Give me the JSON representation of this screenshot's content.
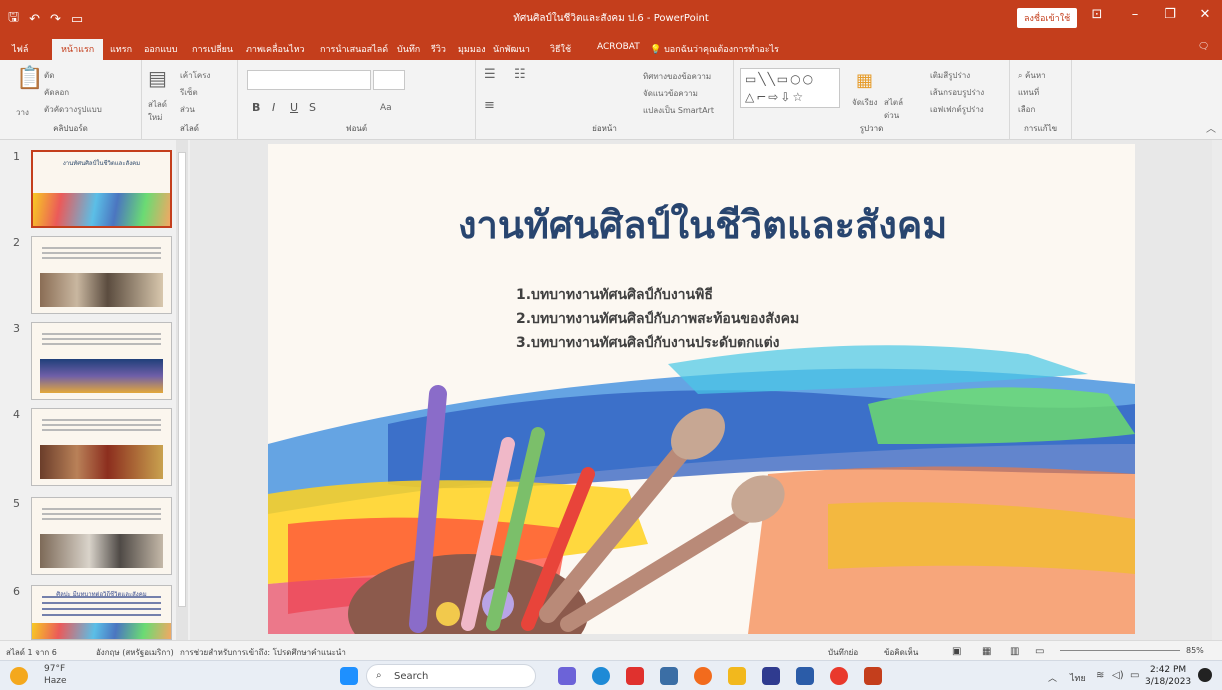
{
  "window": {
    "title": "ทัศนศิลป์ในชีวิตและสังคม ป.6  -  PowerPoint",
    "signin": "ลงชื่อเข้าใช้"
  },
  "tabs": [
    "ไฟล์",
    "หน้าแรก",
    "แทรก",
    "ออกแบบ",
    "การเปลี่ยน",
    "ภาพเคลื่อนไหว",
    "การนำเสนอสไลด์",
    "บันทึก",
    "รีวิว",
    "มุมมอง",
    "นักพัฒนา",
    "วิธีใช้",
    "ACROBAT"
  ],
  "tellme": "บอกฉันว่าคุณต้องการทำอะไร",
  "ribbon": {
    "clipboard": {
      "paste": "วาง",
      "cut": "ตัด",
      "copy": "คัดลอก",
      "format_painter": "ตัวคัดวางรูปแบบ",
      "label": "คลิปบอร์ด"
    },
    "slides": {
      "new_slide": "สไลด์ ใหม่",
      "layout": "เค้าโครง",
      "reset": "รีเซ็ต",
      "section": "ส่วน",
      "label": "สไลด์"
    },
    "font": {
      "label": "ฟอนต์",
      "bold": "B",
      "italic": "I",
      "underline": "U",
      "strike": "S",
      "case": "Aa"
    },
    "paragraph": {
      "text_direction": "ทิศทางของข้อความ",
      "align_text": "จัดแนวข้อความ",
      "smartart": "แปลงเป็น SmartArt",
      "label": "ย่อหน้า"
    },
    "drawing": {
      "arrange": "จัดเรียง",
      "quick_styles": "สไตล์ ด่วน",
      "fill": "เติมสีรูปร่าง",
      "outline": "เส้นกรอบรูปร่าง",
      "effects": "เอฟเฟกต์รูปร่าง",
      "label": "รูปวาด"
    },
    "editing": {
      "find": "ค้นหา",
      "replace": "แทนที่",
      "select": "เลือก",
      "label": "การแก้ไข"
    }
  },
  "thumbnails": [
    {
      "num": "1",
      "title": "งานทัศนศิลป์ในชีวิตและสังคม"
    },
    {
      "num": "2"
    },
    {
      "num": "3"
    },
    {
      "num": "4"
    },
    {
      "num": "5"
    },
    {
      "num": "6",
      "title": "ศิลปะ มีบทบาทต่อวิถีชีวิตและสังคม"
    }
  ],
  "slide": {
    "title": "งานทัศนศิลป์ในชีวิตและสังคม",
    "bullets": [
      "1.บทบาทงานทัศนศิลป์กับงานพิธี",
      "2.บทบาทงานทัศนศิลป์กับภาพสะท้อนของสังคม",
      "3.บทบาทงานทัศนศิลป์กับงานประดับตกแต่ง"
    ]
  },
  "status": {
    "slide_of": "สไลด์ 1 จาก 6",
    "language": "อังกฤษ (สหรัฐอเมริกา)",
    "accessibility": "การช่วยสำหรับการเข้าถึง: โปรดศึกษาคำแนะนำ",
    "notes": "บันทึกย่อ",
    "comments": "ข้อคิดเห็น",
    "zoom": "85%"
  },
  "taskbar": {
    "temp": "97°F",
    "weather": "Haze",
    "search": "Search",
    "lang": "ไทย",
    "time": "2:42 PM",
    "date": "3/18/2023"
  },
  "colors": {
    "accent": "#c43e1c",
    "slide_title": "#28456f"
  }
}
